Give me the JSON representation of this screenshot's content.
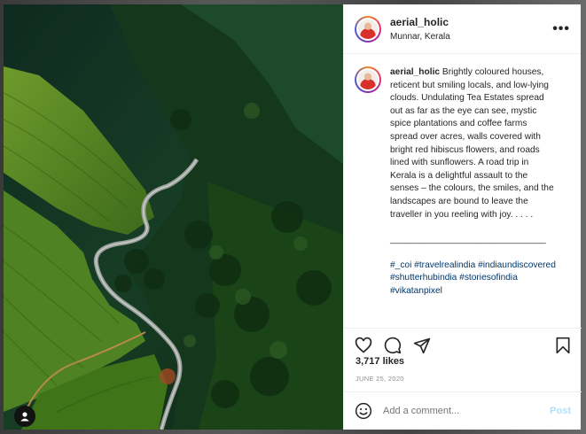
{
  "post": {
    "username": "aerial_holic",
    "location": "Munnar, Kerala",
    "more_icon": "more-horizontal-icon",
    "caption_user": "aerial_holic",
    "caption_text": "Brightly coloured houses, reticent but smiling locals, and low-lying clouds. Undulating Tea Estates spread out as far as the eye can see, mystic spice plantations and coffee farms spread over acres, walls covered with bright red hibiscus flowers, and roads lined with sunflowers. A road trip in Kerala is a delightful assault to the senses – the colours, the smiles, and the landscapes are bound to leave the traveller in you reeling with joy. . . . .",
    "separator": "_______________________________",
    "hashtags": "#_coi #travelrealindia #indiaundiscovered #shutterhubindia #storiesofindia #vikatanpixel",
    "likes": "3,717 likes",
    "date": "JUNE 25, 2020"
  },
  "actions": {
    "icons": [
      "heart-icon",
      "comment-icon",
      "share-icon",
      "bookmark-icon"
    ]
  },
  "comment_box": {
    "placeholder": "Add a comment...",
    "post_label": "Post",
    "emoji_icon": "emoji-icon"
  },
  "photo": {
    "tag_icon": "user-tag-icon"
  }
}
